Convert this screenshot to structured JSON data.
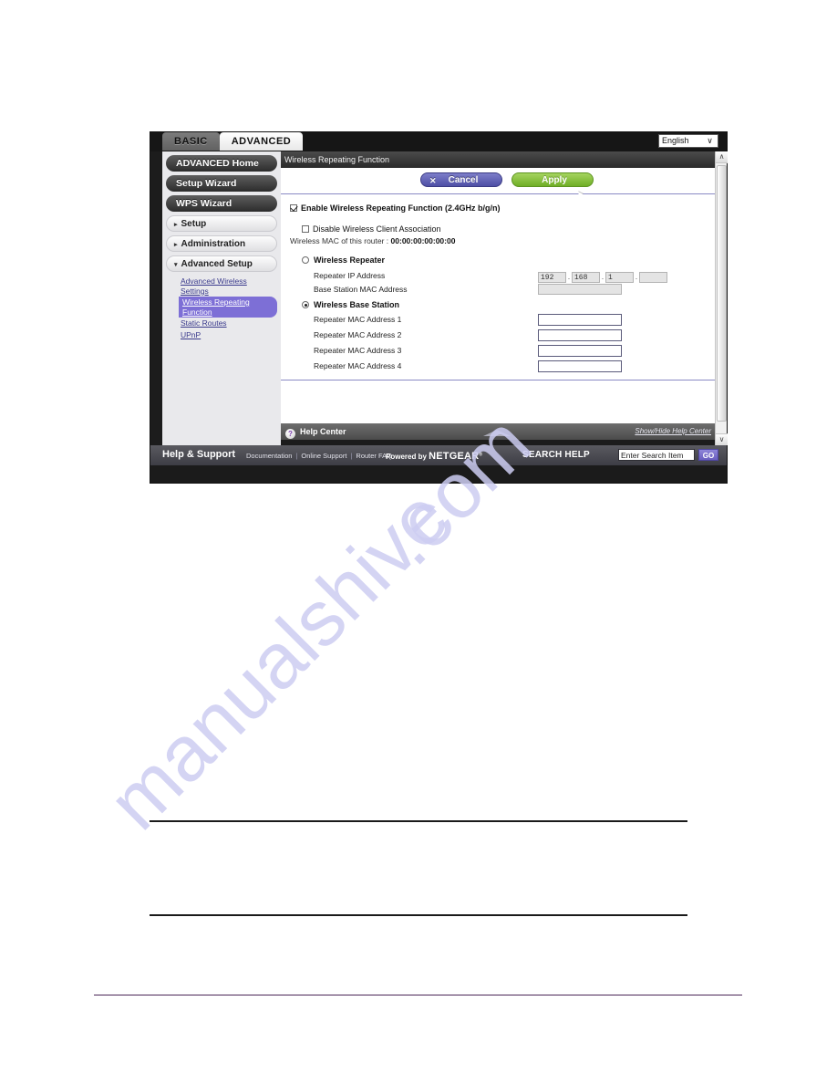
{
  "watermark": {
    "line1": "manualshive",
    "line2": ".com"
  },
  "header": {
    "tabs": [
      {
        "label": "BASIC",
        "active": false
      },
      {
        "label": "ADVANCED",
        "active": true
      }
    ],
    "language": {
      "selected": "English",
      "caret_icon": "chevron-down-icon"
    }
  },
  "sidebar": {
    "buttons": [
      {
        "label": "ADVANCED Home"
      },
      {
        "label": "Setup Wizard"
      },
      {
        "label": "WPS Wizard"
      }
    ],
    "sections": [
      {
        "label": "Setup",
        "arrow": "▸",
        "expanded": false
      },
      {
        "label": "Administration",
        "arrow": "▸",
        "expanded": false
      },
      {
        "label": "Advanced Setup",
        "arrow": "▾",
        "expanded": true
      }
    ],
    "sub_items": [
      {
        "label": "Advanced Wireless Settings",
        "selected": false
      },
      {
        "label": "Wireless Repeating Function",
        "selected": true
      },
      {
        "label": "Static Routes",
        "selected": false
      },
      {
        "label": "UPnP",
        "selected": false
      }
    ]
  },
  "panel": {
    "title": "Wireless Repeating Function",
    "buttons": {
      "cancel": {
        "label": "Cancel",
        "glyph": "✕",
        "icon": "close-icon"
      },
      "apply": {
        "label": "Apply",
        "glyph": "▶",
        "icon": "play-arrow-icon"
      }
    },
    "enable_checkbox": {
      "label": "Enable Wireless Repeating Function (2.4GHz b/g/n)",
      "checked": true
    },
    "disable_assoc_checkbox": {
      "label": "Disable Wireless Client Association",
      "checked": false
    },
    "mac_line": {
      "label": "Wireless MAC of this router :",
      "value": "00:00:00:00:00:00"
    },
    "repeater_radio": {
      "label": "Wireless Repeater",
      "selected": false
    },
    "repeater_ip": {
      "label": "Repeater IP Address",
      "octets": [
        "192",
        "168",
        "1",
        ""
      ],
      "separator": "."
    },
    "base_station_mac": {
      "label": "Base Station MAC Address",
      "value": ""
    },
    "base_station_radio": {
      "label": "Wireless Base Station",
      "selected": true
    },
    "repeater_macs": [
      {
        "label": "Repeater MAC Address 1",
        "value": ""
      },
      {
        "label": "Repeater MAC Address 2",
        "value": ""
      },
      {
        "label": "Repeater MAC Address 3",
        "value": ""
      },
      {
        "label": "Repeater MAC Address 4",
        "value": ""
      }
    ]
  },
  "help_center": {
    "icon": "question-mark-icon",
    "icon_glyph": "?",
    "label": "Help Center",
    "toggle_link": "Show/Hide Help Center",
    "collapse_icon": "chevron-down-icon",
    "collapse_glyph": "∨"
  },
  "scrollbar": {
    "up_glyph": "∧",
    "down_glyph": "∨",
    "up_icon": "chevron-up-icon",
    "down_icon": "chevron-down-icon"
  },
  "footer": {
    "title": "Help & Support",
    "links": [
      "Documentation",
      "Online Support",
      "Router FAQ"
    ],
    "separator": "|",
    "powered_prefix": "Powered by ",
    "brand": "NETGEAR",
    "brand_mark": "®",
    "search_label": "SEARCH HELP",
    "search_placeholder": "Enter Search Item",
    "search_value": "Enter Search Item",
    "go_label": "GO"
  },
  "colors": {
    "accent_purple": "#7d6fd6",
    "apply_green": "#6fae26",
    "cancel_blue": "#4e4fa5",
    "watermark": "#cdcdf2"
  }
}
